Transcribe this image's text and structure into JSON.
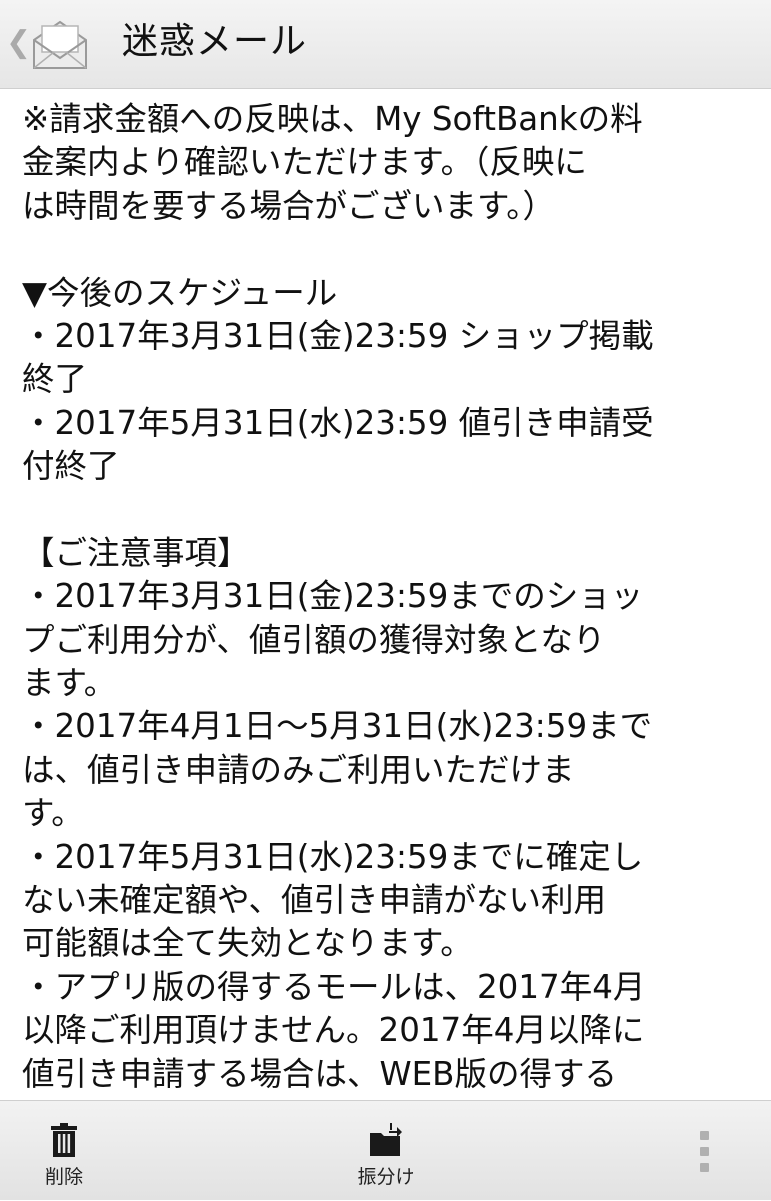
{
  "header": {
    "back_glyph": "❮",
    "icon": "envelope-open-icon",
    "title": "迷惑メール"
  },
  "message": {
    "lines": [
      "※請求金額への反映は、My SoftBankの料",
      "金案内より確認いただけます。（反映に",
      "は時間を要する場合がございます。）",
      "",
      "▼今後のスケジュール",
      "・2017年3月31日(金)23:59 ショップ掲載",
      "終了",
      "・2017年5月31日(水)23:59 値引き申請受",
      "付終了",
      "",
      "【ご注意事項】",
      "・2017年3月31日(金)23:59までのショッ",
      "プご利用分が、値引額の獲得対象となり",
      "ます。",
      "・2017年4月1日～5月31日(水)23:59まで",
      "は、値引き申請のみご利用いただけま",
      "す。",
      "・2017年5月31日(水)23:59までに確定し",
      "ない未確定額や、値引き申請がない利用",
      "可能額は全て失効となります。",
      "・アプリ版の得するモールは、2017年4月",
      "以降ご利用頂けません。2017年4月以降に",
      "値引き申請する場合は、WEB版の得する"
    ]
  },
  "toolbar": {
    "delete_label": "削除",
    "delete_icon": "trash-icon",
    "sort_label": "振分け",
    "sort_icon": "folder-move-icon",
    "more_icon": "overflow-menu-icon"
  }
}
